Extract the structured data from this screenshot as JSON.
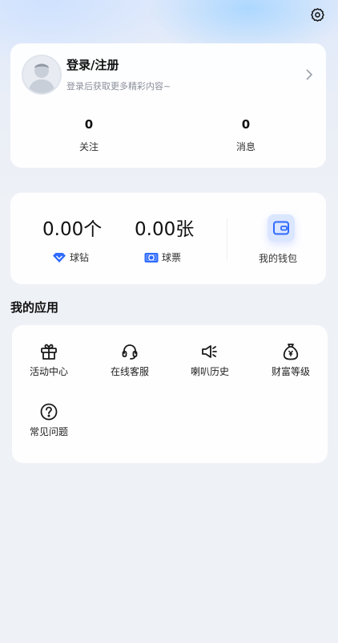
{
  "profile": {
    "login_title": "登录/注册",
    "login_subtitle": "登录后获取更多精彩内容~",
    "stats": [
      {
        "value": "0",
        "label": "关注"
      },
      {
        "value": "0",
        "label": "消息"
      }
    ]
  },
  "wallet": {
    "diamond_amount": "0.00个",
    "diamond_label": "球钻",
    "ticket_amount": "0.00张",
    "ticket_label": "球票",
    "wallet_label": "我的钱包"
  },
  "apps": {
    "section_title": "我的应用",
    "items": [
      {
        "label": "活动中心",
        "icon": "gift-icon"
      },
      {
        "label": "在线客服",
        "icon": "headset-icon"
      },
      {
        "label": "喇叭历史",
        "icon": "speaker-icon"
      },
      {
        "label": "财富等级",
        "icon": "money-bag-icon"
      },
      {
        "label": "常见问题",
        "icon": "question-icon"
      }
    ]
  },
  "colors": {
    "accent": "#2f6bff",
    "background": "#eef1f6",
    "card": "#ffffff"
  },
  "icons": {
    "settings": "gear-icon",
    "chevron": "chevron-right-icon",
    "avatar": "avatar"
  }
}
